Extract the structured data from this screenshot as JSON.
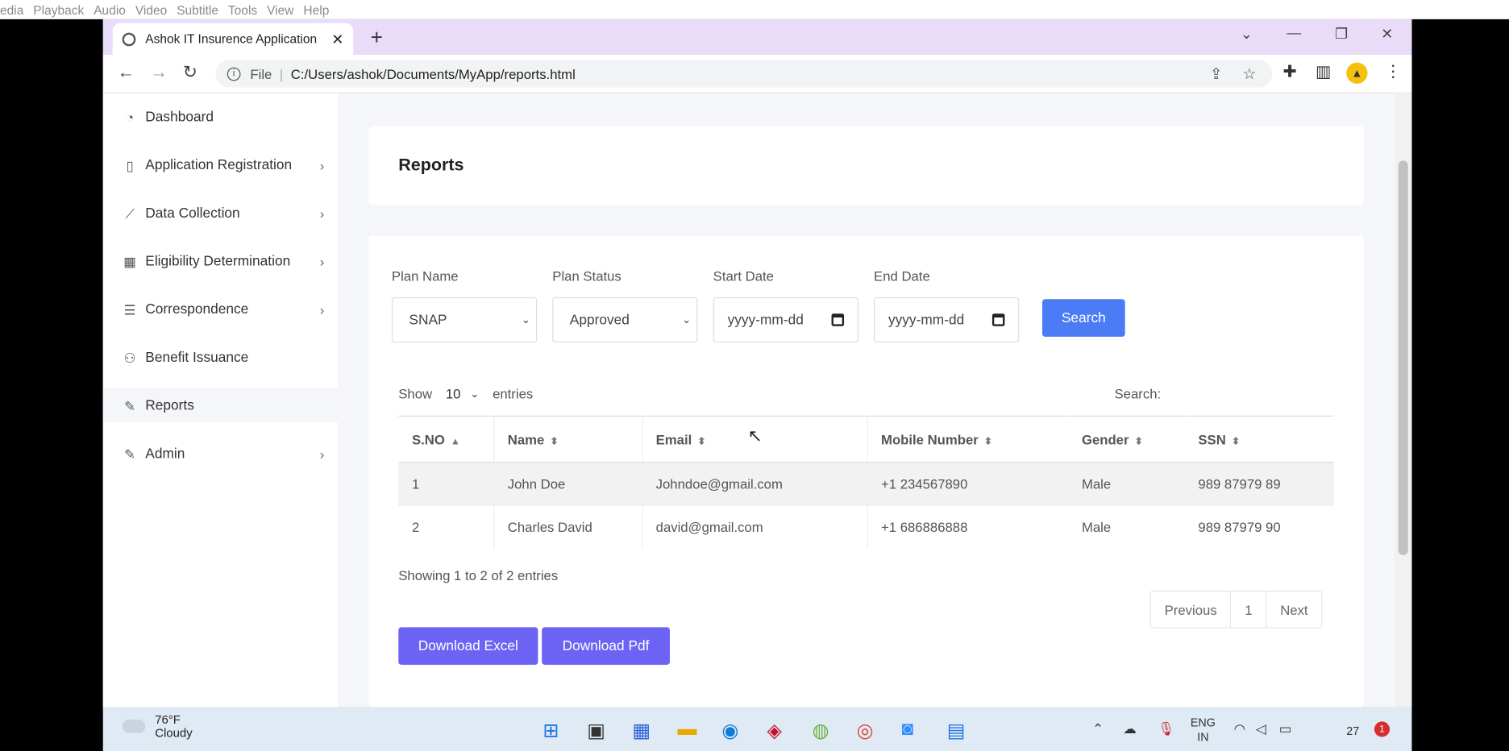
{
  "player_menu": [
    "edia",
    "Playback",
    "Audio",
    "Video",
    "Subtitle",
    "Tools",
    "View",
    "Help"
  ],
  "browser": {
    "tab_title": "Ashok IT Insurence Application",
    "new_tab": "+",
    "url_scheme": "File",
    "url": "C:/Users/ashok/Documents/MyApp/reports.html"
  },
  "sidebar": {
    "items": [
      {
        "label": "Dashboard",
        "icon": "gauge-icon",
        "chevron": false
      },
      {
        "label": "Application Registration",
        "icon": "tablet-icon",
        "chevron": true
      },
      {
        "label": "Data Collection",
        "icon": "chart-line-icon",
        "chevron": true
      },
      {
        "label": "Eligibility Determination",
        "icon": "grid-icon",
        "chevron": true
      },
      {
        "label": "Correspondence",
        "icon": "menu-icon",
        "chevron": true
      },
      {
        "label": "Benefit Issuance",
        "icon": "award-icon",
        "chevron": false
      },
      {
        "label": "Reports",
        "icon": "edit-icon",
        "chevron": false
      },
      {
        "label": "Admin",
        "icon": "edit-icon",
        "chevron": true
      }
    ]
  },
  "reports": {
    "title": "Reports",
    "filters": {
      "plan_name_label": "Plan Name",
      "plan_name_value": "SNAP",
      "plan_status_label": "Plan Status",
      "plan_status_value": "Approved",
      "start_date_label": "Start Date",
      "start_date_placeholder": "yyyy-mm-dd",
      "end_date_label": "End Date",
      "end_date_placeholder": "yyyy-mm-dd",
      "search_button": "Search"
    },
    "table_controls": {
      "show": "Show",
      "entries_value": "10",
      "entries": "entries",
      "search_label": "Search:"
    },
    "columns": [
      "S.NO",
      "Name",
      "Email",
      "Mobile Number",
      "Gender",
      "SSN"
    ],
    "rows": [
      [
        "1",
        "John Doe",
        "Johndoe@gmail.com",
        "+1 234567890",
        "Male",
        "989 87979 89"
      ],
      [
        "2",
        "Charles David",
        "david@gmail.com",
        "+1 686886888",
        "Male",
        "989 87979 90"
      ]
    ],
    "showing_text": "Showing 1 to 2 of 2 entries",
    "pagination": {
      "previous": "Previous",
      "page": "1",
      "next": "Next"
    },
    "download_excel": "Download Excel",
    "download_pdf": "Download Pdf"
  },
  "taskbar": {
    "temperature": "76°F",
    "weather": "Cloudy",
    "language": "ENG",
    "region": "IN",
    "time": "27",
    "notifications": "1"
  },
  "colors": {
    "tab_strip": "#e8dcf8",
    "search_button": "#4b7bf5",
    "download_buttons": "#6c63f5",
    "taskbar": "#dfeaf4"
  }
}
